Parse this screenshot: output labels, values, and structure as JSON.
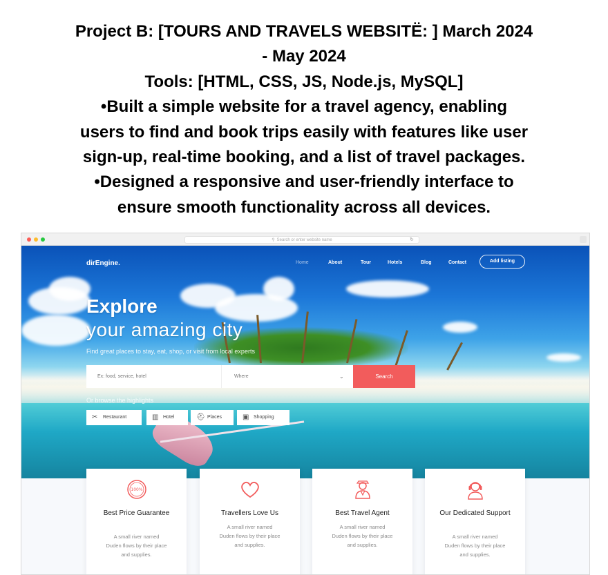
{
  "header": {
    "line1": "Project B: [TOURS AND TRAVELS WEBSITË: ] March 2024",
    "line2": "- May 2024",
    "line3": "Tools: [HTML, CSS, JS, Node.js, MySQL]",
    "line4": "•Built a simple website for a travel agency, enabling",
    "line5": "users to find and book trips easily with features like user",
    "line6": "sign-up, real-time booking, and a list of travel packages.",
    "line7": "•Designed a responsive and user-friendly interface to",
    "line8": "ensure smooth functionality across all devices."
  },
  "browser": {
    "url_placeholder": "Search or enter website name"
  },
  "site": {
    "logo": "dirEngine.",
    "nav": [
      "Home",
      "About",
      "Tour",
      "Hotels",
      "Blog",
      "Contact"
    ],
    "nav_button": "Add listing",
    "hero_title": "Explore",
    "hero_subtitle": "your amazing city",
    "hero_tagline": "Find great places to stay, eat, shop, or visit from local experts",
    "search": {
      "what_placeholder": "Ex: food, service, hotel",
      "where_placeholder": "Where",
      "button": "Search"
    },
    "browse_label": "Or browse the highlights",
    "chips": [
      {
        "label": "Restaurant",
        "icon": "utensils-icon"
      },
      {
        "label": "Hotel",
        "icon": "hotel-icon"
      },
      {
        "label": "Places",
        "icon": "places-icon"
      },
      {
        "label": "Shopping",
        "icon": "shopping-icon"
      }
    ],
    "features": [
      {
        "title": "Best Price Guarantee",
        "desc": "A small river named Duden flows by their place and supplies.",
        "icon": "guarantee-badge-icon"
      },
      {
        "title": "Travellers Love Us",
        "desc": "A small river named Duden flows by their place and supplies.",
        "icon": "heart-icon"
      },
      {
        "title": "Best Travel Agent",
        "desc": "A small river named Duden flows by their place and supplies.",
        "icon": "travel-agent-icon"
      },
      {
        "title": "Our Dedicated Support",
        "desc": "A small river named Duden flows by their place and supplies.",
        "icon": "support-headset-icon"
      }
    ],
    "badge_text": "100%"
  },
  "colors": {
    "accent": "#f25c5c",
    "hero_sky": "#1c77d8",
    "sea": "#1fa8c6"
  }
}
